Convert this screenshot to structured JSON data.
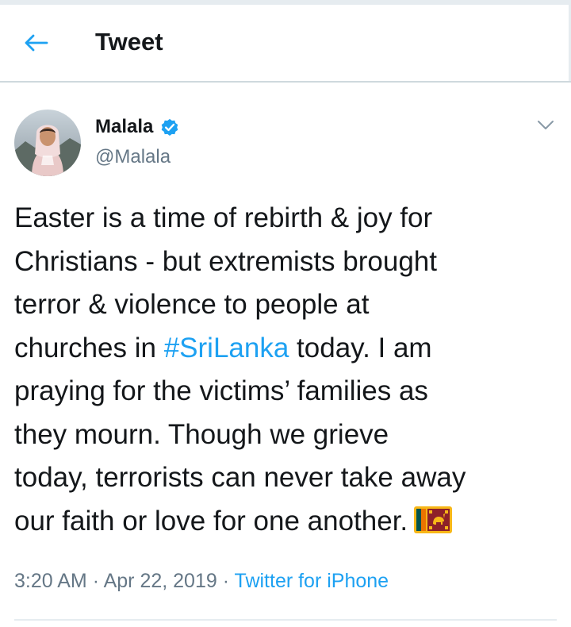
{
  "header": {
    "back_icon": "arrow-left-icon",
    "title": "Tweet"
  },
  "author": {
    "display_name": "Malala",
    "verified_icon": "verified-badge-icon",
    "handle": "@Malala",
    "avatar_icon": "profile-photo"
  },
  "tweet": {
    "lines": [
      "Easter is a time of rebirth & joy for",
      "Christians - but extremists brought",
      "terror & violence to people at"
    ],
    "line4_before": "churches in ",
    "hashtag": "#SriLanka",
    "line4_after": " today. I am",
    "lines_after": [
      "praying for the victims’ families as",
      "they mourn. Though we grieve",
      "today, terrorists can never take away"
    ],
    "last_line": "our faith or love for one another.",
    "flag_icon": "sri-lanka-flag-emoji"
  },
  "meta": {
    "time": "3:20 AM",
    "separator": "·",
    "date": "Apr 22, 2019",
    "source": "Twitter for iPhone"
  },
  "menu": {
    "caret_icon": "chevron-down-icon"
  },
  "colors": {
    "accent": "#1da1f2",
    "text": "#14171a",
    "secondary": "#657786"
  }
}
